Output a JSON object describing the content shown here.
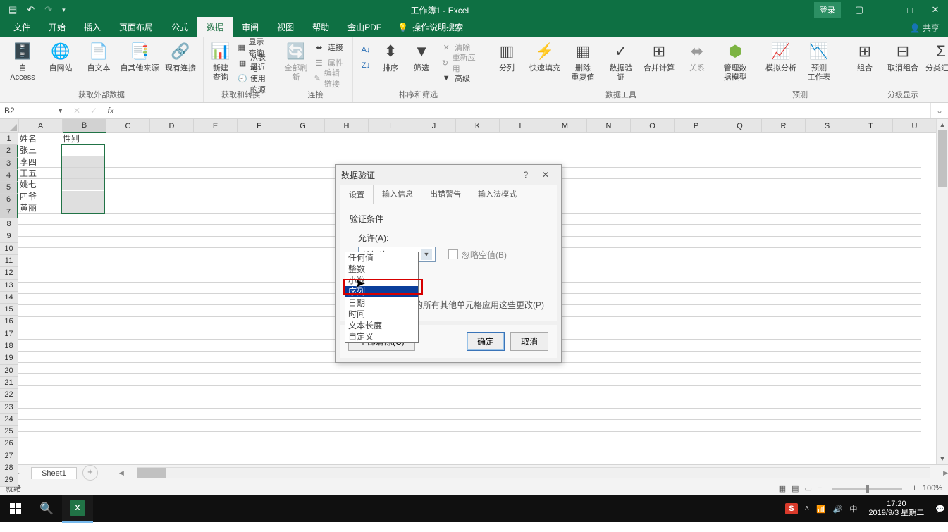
{
  "titlebar": {
    "title": "工作簿1  -  Excel",
    "login": "登录"
  },
  "menu": {
    "file": "文件",
    "home": "开始",
    "insert": "插入",
    "layout": "页面布局",
    "formula": "公式",
    "data": "数据",
    "review": "审阅",
    "view": "视图",
    "help": "帮助",
    "pdf": "金山PDF",
    "search": "操作说明搜索",
    "share": "共享"
  },
  "ribbon": {
    "g1": {
      "label": "获取外部数据",
      "access": "自 Access",
      "web": "自网站",
      "text": "自文本",
      "other": "自其他来源",
      "conn": "现有连接"
    },
    "g2": {
      "label": "获取和转换",
      "new": "新建\n查询",
      "showq": "显示查询",
      "fromtable": "从表格",
      "recent": "最近使用的源"
    },
    "g3": {
      "label": "连接",
      "refresh": "全部刷新",
      "conn": "连接",
      "prop": "属性",
      "editlink": "编辑链接"
    },
    "g4": {
      "label": "排序和筛选",
      "az": "A↓Z",
      "za": "Z↓A",
      "sort": "排序",
      "filter": "筛选",
      "clear": "清除",
      "reapply": "重新应用",
      "adv": "高级"
    },
    "g5": {
      "label": "数据工具",
      "split": "分列",
      "flash": "快速填充",
      "dedup": "删除\n重复值",
      "valid": "数据验\n证",
      "consol": "合并计算",
      "rel": "关系",
      "model": "管理数\n据模型"
    },
    "g6": {
      "label": "预测",
      "whatif": "模拟分析",
      "forecast": "预测\n工作表"
    },
    "g7": {
      "label": "分级显示",
      "group": "组合",
      "ungroup": "取消组合",
      "subtotal": "分类汇总"
    }
  },
  "namebox": "B2",
  "cols": [
    "A",
    "B",
    "C",
    "D",
    "E",
    "F",
    "G",
    "H",
    "I",
    "J",
    "K",
    "L",
    "M",
    "N",
    "O",
    "P",
    "Q",
    "R",
    "S",
    "T",
    "U"
  ],
  "rows": 29,
  "cells": {
    "A1": "姓名",
    "B1": "性别",
    "A2": "张三",
    "A3": "李四",
    "A4": "王五",
    "A5": "姚七",
    "A6": "四爷",
    "A7": "黄丽"
  },
  "dialog": {
    "title": "数据验证",
    "tabs": {
      "t1": "设置",
      "t2": "输入信息",
      "t3": "出错警告",
      "t4": "输入法模式"
    },
    "section": "验证条件",
    "allow": "允许(A):",
    "comboval": "任何值",
    "ignore": "忽略空值(B)",
    "apply": "对有同样设置的所有其他单元格应用这些更改(P)",
    "clearall": "全部清除(C)",
    "ok": "确定",
    "cancel": "取消",
    "opts": [
      "任何值",
      "整数",
      "小数",
      "序列",
      "日期",
      "时间",
      "文本长度",
      "自定义"
    ]
  },
  "sheet": "Sheet1",
  "status": "就绪",
  "zoom": "100%",
  "clock": {
    "time": "17:20",
    "date": "2019/9/3 星期二"
  }
}
